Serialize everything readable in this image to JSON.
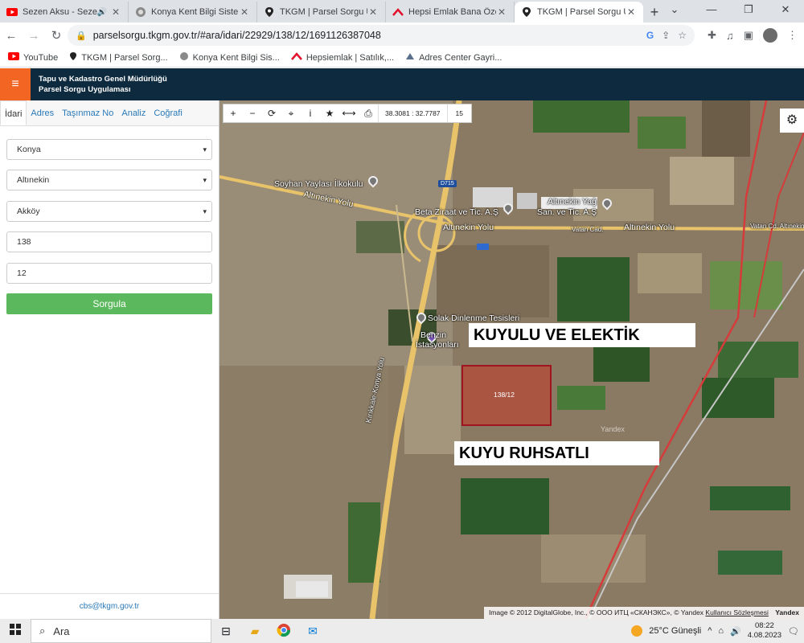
{
  "browser": {
    "tabs": [
      {
        "title": "Sezen Aksu - Sezen A",
        "icon": "youtube-icon",
        "audio": true,
        "active": false
      },
      {
        "title": "Konya Kent Bilgi Sistemi",
        "icon": "konya-logo-icon",
        "audio": false,
        "active": false
      },
      {
        "title": "TKGM | Parsel Sorgu Uygu",
        "icon": "map-pin-icon",
        "audio": false,
        "active": false
      },
      {
        "title": "Hepsi Emlak Bana Özel",
        "icon": "hepsiemlak-icon",
        "audio": false,
        "active": false
      },
      {
        "title": "TKGM | Parsel Sorgu Uygu",
        "icon": "map-pin-icon",
        "audio": false,
        "active": true
      }
    ],
    "url": "parselsorgu.tkgm.gov.tr/#ara/idari/22929/138/12/1691126387048",
    "bookmarks": [
      {
        "label": "YouTube",
        "icon": "youtube-icon"
      },
      {
        "label": "TKGM | Parsel Sorg...",
        "icon": "map-pin-icon"
      },
      {
        "label": "Konya Kent Bilgi Sis...",
        "icon": "konya-logo-icon"
      },
      {
        "label": "Hepsiemlak | Satılık,...",
        "icon": "hepsiemlak-icon"
      },
      {
        "label": "Adres Center Gayri...",
        "icon": "adres-center-icon"
      }
    ]
  },
  "app": {
    "title_line1": "Tapu ve Kadastro Genel Müdürlüğü",
    "title_line2": "Parsel Sorgu Uygulaması"
  },
  "panel": {
    "tabs": [
      "İdari",
      "Adres",
      "Taşınmaz No",
      "Analiz",
      "Coğrafi"
    ],
    "province": "Konya",
    "district": "Altınekin",
    "neighborhood": "Akköy",
    "block": "138",
    "parcel": "12",
    "query_label": "Sorgula",
    "footer_email": "cbs@tkgm.gov.tr"
  },
  "map": {
    "coords": "38.3081 : 32.7787",
    "zoom": "15",
    "labels": {
      "soyhan": "Soyhan Yaylası İlkokulu",
      "altinekin_yolu_1": "Altınekin Yolu",
      "beta": "Beta Ziraat ve Tic. A.Ş",
      "altinekin_yag": "Altınekin Yağ",
      "san_tic": "San. ve Tic. A.Ş",
      "altinekin_yolu_2": "Altınekin Yolu",
      "altinekin_yolu_3": "Altınekin Yolu",
      "vatan_cad_1": "Vatan Cad.",
      "vatan_cad_2": "Vatan Cd. Altınekin",
      "solak": "Solak Dinlenme Tesisleri",
      "benzin": "Benzin",
      "istasyonlari": "İstasyonları",
      "road_vertical": "Kırıkkale-Konya Yolu",
      "road_shield": "D715",
      "yandex_watermark": "Yandex"
    },
    "banner_top": "KUYULU VE ELEKTİK",
    "banner_bottom": "KUYU RUHSATLI",
    "parcel_label": "138/12",
    "attribution": "Image © 2012 DigitalGlobe, Inc., © ООО ИТЦ «СКАНЭКС», © Yandex",
    "attribution_link": "Kullanıcı Sözleşmesi",
    "attribution_brand": "Yandex"
  },
  "taskbar": {
    "search_placeholder": "Ara",
    "weather": "25°C Güneşli",
    "time": "08:22",
    "date": "4.08.2023"
  }
}
